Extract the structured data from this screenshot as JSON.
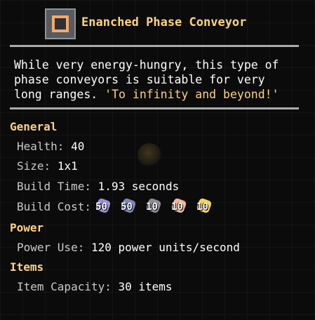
{
  "tooltip": {
    "title": "Enanched Phase Conveyor",
    "description": "While very energy-hungry, this type of phase conveyors is suitable for very long ranges.",
    "flavor": "'To infinity and beyond!'",
    "sections": {
      "general": "General",
      "power": "Power",
      "items": "Items"
    },
    "stats": {
      "health_label": "Health:",
      "health_value": "40",
      "size_label": "Size:",
      "size_value": "1x1",
      "build_time_label": "Build Time:",
      "build_time_value": "1.93 seconds",
      "build_cost_label": "Build Cost:",
      "power_use_label": "Power Use:",
      "power_use_value": "120 power units/second",
      "item_capacity_label": "Item Capacity:",
      "item_capacity_value": "30 items"
    },
    "build_cost": [
      {
        "amount": "50",
        "icon": "phase-fabric-icon",
        "color": "#9a8fd6"
      },
      {
        "amount": "50",
        "icon": "silicon-icon",
        "color": "#7d86b8"
      },
      {
        "amount": "10",
        "icon": "graphite-icon",
        "color": "#8a8d96"
      },
      {
        "amount": "10",
        "icon": "plastanium-icon",
        "color": "#f2b59a"
      },
      {
        "amount": "10",
        "icon": "surge-alloy-icon",
        "color": "#f2d35b"
      }
    ],
    "colors": {
      "accent": "#ffd37f",
      "icon_orange": "#f0aa6c",
      "label_gray": "#c9c9c9",
      "divider": "#ababab"
    }
  }
}
